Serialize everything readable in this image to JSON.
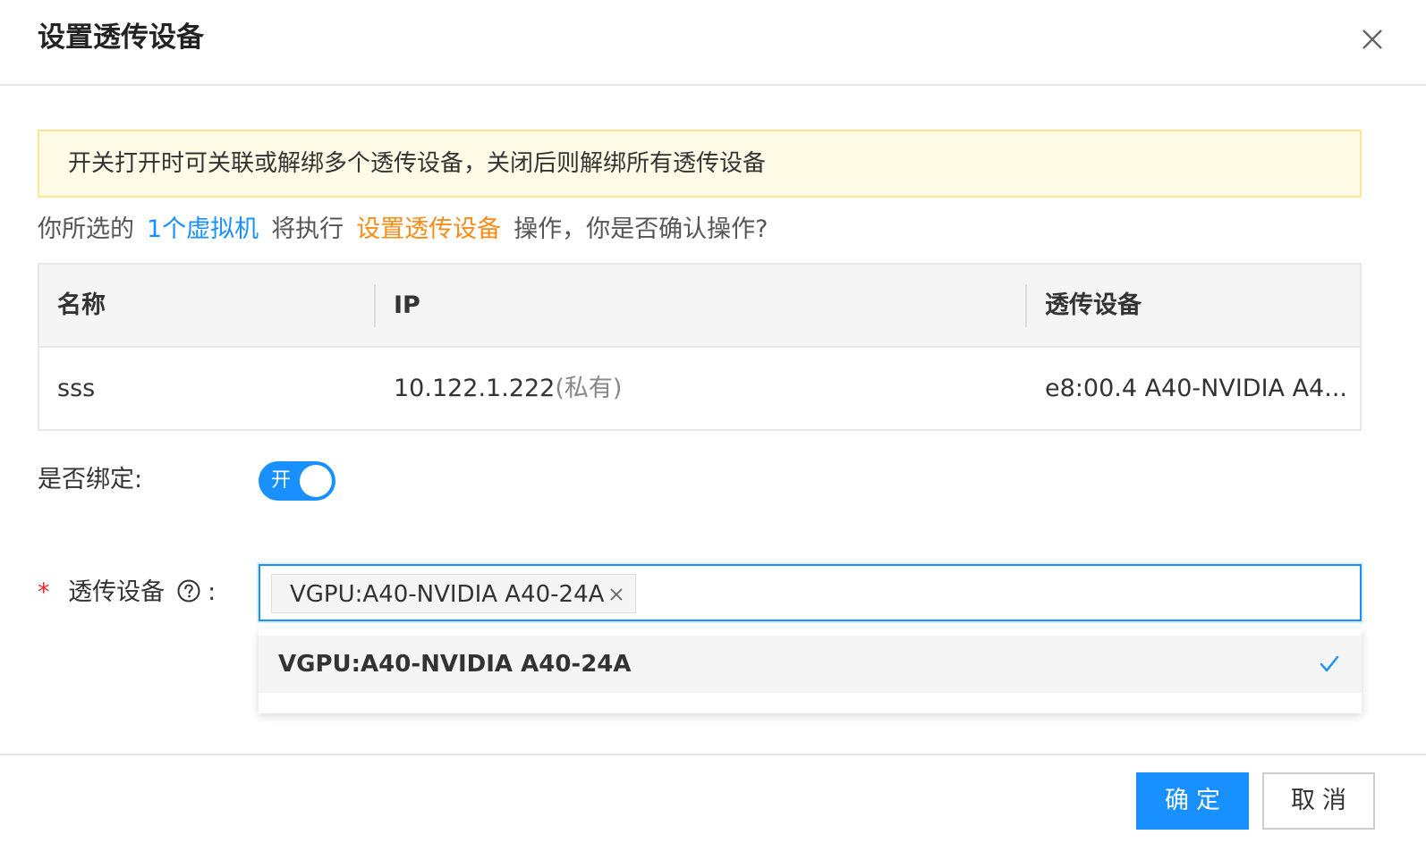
{
  "dialog": {
    "title": "设置透传设备"
  },
  "alert": {
    "text": "开关打开时可关联或解绑多个透传设备，关闭后则解绑所有透传设备"
  },
  "confirm": {
    "prefix": "你所选的",
    "count": "1个虚拟机",
    "middle": "将执行",
    "action": "设置透传设备",
    "suffix": "操作，你是否确认操作?"
  },
  "table": {
    "columns": [
      "名称",
      "IP",
      "透传设备"
    ],
    "rows": [
      {
        "name": "sss",
        "ip": "10.122.1.222",
        "ip_note": "(私有)",
        "device": "e8:00.4 A40-NVIDIA A4..."
      }
    ]
  },
  "form": {
    "bind_label": "是否绑定:",
    "toggle_on_text": "开",
    "device_required_mark": "*",
    "device_label": "透传设备",
    "device_label_colon": ":",
    "selected_tags": [
      "VGPU:A40-NVIDIA A40-24A"
    ],
    "options": [
      {
        "label": "VGPU:A40-NVIDIA A40-24A",
        "selected": true
      }
    ]
  },
  "footer": {
    "ok_label": "确定",
    "cancel_label": "取消"
  },
  "colors": {
    "primary": "#1890ff",
    "warning_text": "#fa8c16",
    "alert_bg": "#fffbe6",
    "alert_border": "#ffe58f",
    "required": "#f5222d"
  },
  "icons": {
    "close": "close-icon",
    "help": "question-circle-icon",
    "tag_remove": "close-icon",
    "selected": "check-icon"
  }
}
